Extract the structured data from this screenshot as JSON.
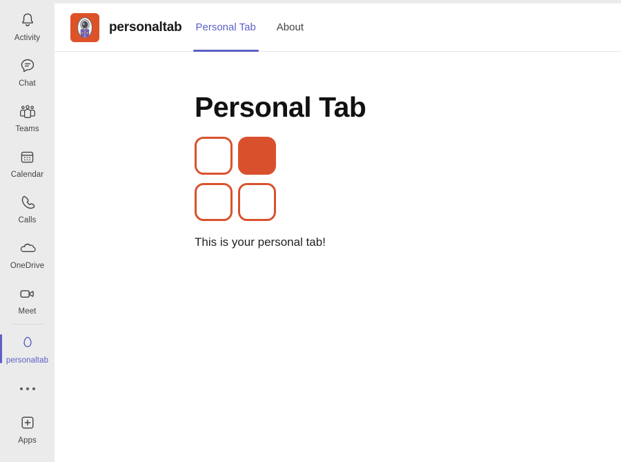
{
  "app": {
    "title": "personaltab",
    "icon_name": "astronaut-app-icon",
    "icon_color": "#dd5228"
  },
  "theme": {
    "accent": "#5b5fc7",
    "rail_background": "#ebebeb",
    "logo_orange": "#d9512c",
    "text_primary": "#212121"
  },
  "rail": {
    "items": [
      {
        "label": "Activity",
        "icon": "bell-icon",
        "active": false
      },
      {
        "label": "Chat",
        "icon": "chat-icon",
        "active": false
      },
      {
        "label": "Teams",
        "icon": "teams-icon",
        "active": false
      },
      {
        "label": "Calendar",
        "icon": "calendar-icon",
        "active": false
      },
      {
        "label": "Calls",
        "icon": "phone-icon",
        "active": false
      },
      {
        "label": "OneDrive",
        "icon": "onedrive-icon",
        "active": false
      },
      {
        "label": "Meet",
        "icon": "video-camera-icon",
        "active": false
      },
      {
        "label": "personaltab",
        "icon": "egg-icon",
        "active": true
      }
    ],
    "more_label": "more-options-icon",
    "apps": {
      "label": "Apps",
      "icon": "plus-square-icon"
    }
  },
  "header": {
    "tabs": [
      {
        "label": "Personal Tab",
        "active": true
      },
      {
        "label": "About",
        "active": false
      }
    ]
  },
  "main": {
    "heading": "Personal Tab",
    "logo": {
      "name": "four-squares-logo",
      "squares": [
        {
          "position": "top-left",
          "filled": false
        },
        {
          "position": "top-right",
          "filled": true
        },
        {
          "position": "bottom-left",
          "filled": false
        },
        {
          "position": "bottom-right",
          "filled": false
        }
      ]
    },
    "body_text": "This is your personal tab!"
  }
}
